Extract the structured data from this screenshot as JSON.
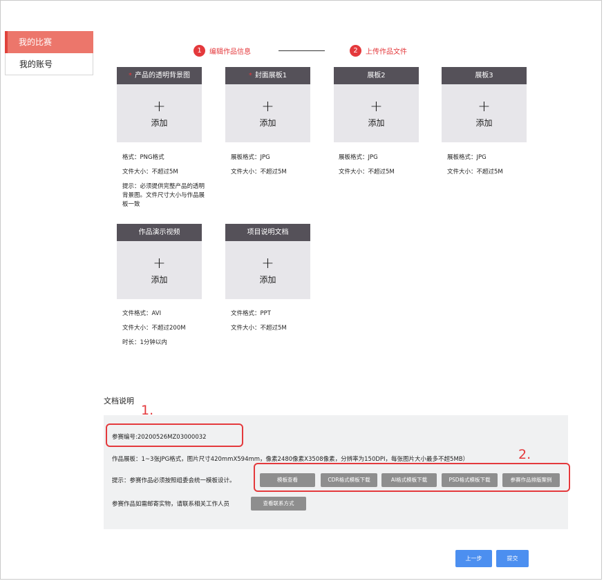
{
  "sidebar": {
    "items": [
      {
        "label": "我的比赛",
        "active": true
      },
      {
        "label": "我的账号",
        "active": false
      }
    ]
  },
  "steps": [
    {
      "num": "1",
      "label": "编辑作品信息"
    },
    {
      "num": "2",
      "label": "上传作品文件"
    }
  ],
  "upload": {
    "plus": "+",
    "add_label": "添加",
    "required_mark": "*",
    "cards": [
      {
        "title": "产品的透明背景图",
        "required": true,
        "info": [
          "格式：PNG格式",
          "文件大小：不超过5M"
        ],
        "tip": "提示：必须提供完整产品的透明背景图。文件尺寸大小与作品展板一致"
      },
      {
        "title": "封面展板1",
        "required": true,
        "info": [
          "展板格式：JPG",
          "文件大小：不超过5M"
        ]
      },
      {
        "title": "展板2",
        "required": false,
        "info": [
          "展板格式：JPG",
          "文件大小：不超过5M"
        ]
      },
      {
        "title": "展板3",
        "required": false,
        "info": [
          "展板格式：JPG",
          "文件大小：不超过5M"
        ]
      },
      {
        "title": "作品演示视频",
        "required": false,
        "info": [
          "文件格式：AVI",
          "文件大小：不超过200M",
          "时长：1分钟以内"
        ]
      },
      {
        "title": "项目说明文档",
        "required": false,
        "info": [
          "文件格式：PPT",
          "文件大小：不超过5M"
        ]
      }
    ]
  },
  "doc": {
    "title": "文档说明",
    "mark1": "1.",
    "mark2": "2.",
    "entry_no": "参赛编号:20200526MZ03000032",
    "board_spec": "作品展板：1~3张JPG格式，图片尺寸420mmX594mm，像素2480像素X3508像素，分辨率为150DPI，每张图片大小最多不超5MB）",
    "tip": "提示：参赛作品必须按照组委会统一模板设计。",
    "buttons": [
      "模板查看",
      "CDR格式模板下载",
      "AI格式模板下载",
      "PSD格式模板下载",
      "参赛作品排版案例"
    ],
    "mail_note": "参赛作品如需邮寄实物，请联系相关工作人员",
    "contact_button": "查看联系方式"
  },
  "actions": {
    "prev": "上一步",
    "submit": "提交"
  },
  "colors": {
    "accent": "#e4393c",
    "sidebar_active": "#ec766b",
    "card_header": "#555159",
    "card_body": "#e7e6ea",
    "primary_button": "#4c8ff0",
    "gray_button": "#8e8e8e"
  }
}
